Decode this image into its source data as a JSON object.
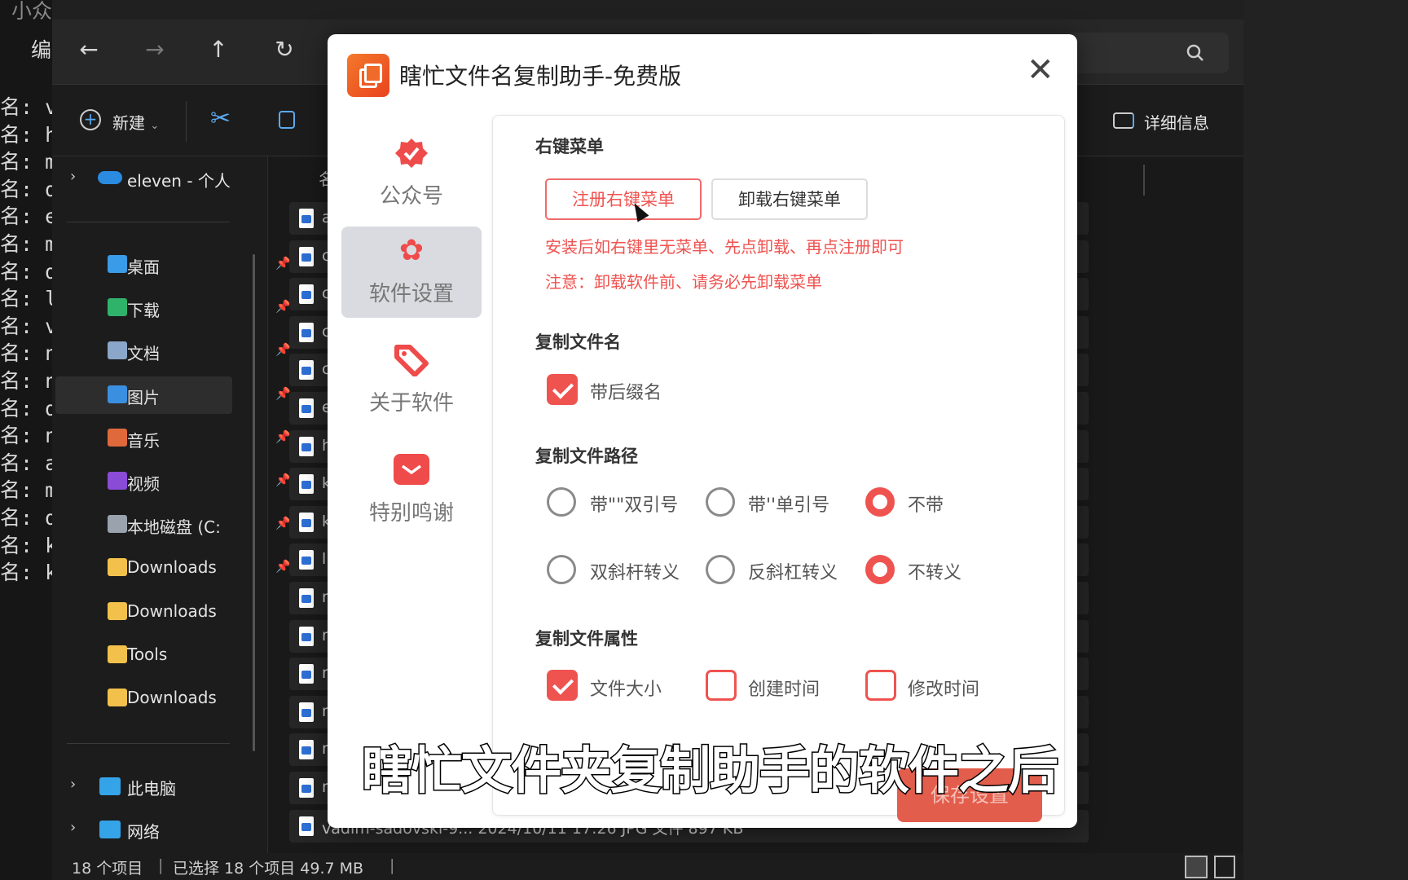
{
  "terminal": {
    "top_text": "小众",
    "menu_char": "编",
    "lines": [
      "名: v",
      "名: h",
      "名: m",
      "名: d",
      "名: e",
      "名: m",
      "名: d",
      "名: la",
      "名: v",
      "名: n",
      "名: n",
      "名: d",
      "名: n",
      "名: a",
      "名: m",
      "名: d",
      "名: k",
      "名: k"
    ]
  },
  "explorer": {
    "nav": {
      "back": "←",
      "forward": "→",
      "up": "↑",
      "refresh": "↻",
      "search_icon": "search-icon"
    },
    "toolbar": {
      "new_label": "新建",
      "details_label": "详细信息"
    },
    "sidebar": {
      "onedrive": "eleven - 个人",
      "items": [
        {
          "label": "桌面",
          "icon": "desktop-icon",
          "color": "#3a9be8",
          "pinned": true
        },
        {
          "label": "下载",
          "icon": "download-icon",
          "color": "#2fb36a",
          "pinned": true
        },
        {
          "label": "文档",
          "icon": "document-icon",
          "color": "#8aa6c8",
          "pinned": true
        },
        {
          "label": "图片",
          "icon": "pictures-icon",
          "color": "#3b8fe0",
          "pinned": true,
          "selected": true
        },
        {
          "label": "音乐",
          "icon": "music-icon",
          "color": "#e0693c",
          "pinned": true
        },
        {
          "label": "视频",
          "icon": "video-icon",
          "color": "#8a4bd6",
          "pinned": true
        },
        {
          "label": "本地磁盘 (C:",
          "icon": "drive-icon",
          "color": "#9aa3ad",
          "pinned": true
        },
        {
          "label": "Downloads",
          "icon": "folder-icon",
          "color": "#f2c14b",
          "pinned": true
        },
        {
          "label": "Downloads",
          "icon": "folder-icon",
          "color": "#f2c14b",
          "pinned": false
        },
        {
          "label": "Tools",
          "icon": "folder-icon",
          "color": "#f2c14b",
          "pinned": false
        },
        {
          "label": "Downloads",
          "icon": "folder-icon",
          "color": "#f2c14b",
          "pinned": false
        }
      ],
      "this_pc": "此电脑",
      "network": "网络"
    },
    "column_name": "名",
    "files": [
      "a",
      "c",
      "c",
      "c",
      "c",
      "e",
      "h",
      "k",
      "k",
      "l",
      "m",
      "m",
      "m",
      "m",
      "m",
      "m",
      "vadim-sadovski-9...   2024/10/11 17:26      JPG 文件      897 KB"
    ],
    "status": {
      "count": "18 个项目",
      "selected": "已选择 18 个项目  49.7 MB"
    }
  },
  "dialog": {
    "title": "瞎忙文件名复制助手-免费版",
    "nav": [
      {
        "label": "公众号",
        "icon": "badge-check-icon"
      },
      {
        "label": "软件设置",
        "icon": "gear-icon",
        "selected": true
      },
      {
        "label": "关于软件",
        "icon": "tag-icon"
      },
      {
        "label": "特别鸣谢",
        "icon": "mail-icon"
      }
    ],
    "context_menu": {
      "heading": "右键菜单",
      "register": "注册右键菜单",
      "unregister": "卸载右键菜单",
      "tip1": "安装后如右键里无菜单、先点卸载、再点注册即可",
      "tip2": "注意：卸载软件前、请务必先卸载菜单"
    },
    "copy_name": {
      "heading": "复制文件名",
      "with_ext": {
        "label": "带后缀名",
        "checked": true
      }
    },
    "copy_path": {
      "heading": "复制文件路径",
      "quote_options": [
        {
          "label": "带\"\"双引号",
          "selected": false
        },
        {
          "label": "带''单引号",
          "selected": false
        },
        {
          "label": "不带",
          "selected": true
        }
      ],
      "escape_options": [
        {
          "label": "双斜杆转义",
          "selected": false
        },
        {
          "label": "反斜杠转义",
          "selected": false
        },
        {
          "label": "不转义",
          "selected": true
        }
      ]
    },
    "copy_attr": {
      "heading": "复制文件属性",
      "options": [
        {
          "label": "文件大小",
          "checked": true
        },
        {
          "label": "创建时间",
          "checked": false
        },
        {
          "label": "修改时间",
          "checked": false
        }
      ]
    },
    "save": "保存设置",
    "accent": "#ef5350"
  },
  "subtitle": "瞎忙文件夹复制助手的软件之后"
}
